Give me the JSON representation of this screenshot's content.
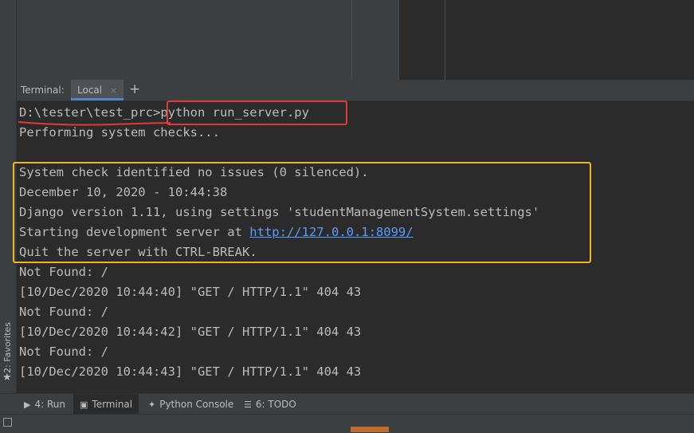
{
  "terminal": {
    "title": "Terminal:",
    "tab_label": "Local",
    "tab_close": "×",
    "add_tab": "+",
    "lines": {
      "cmd_path": "D:\\tester\\test_prc>",
      "cmd_text": "python run_server.py",
      "l1": "Performing system checks...",
      "l2": "System check identified no issues (0 silenced).",
      "l3": "December 10, 2020 - 10:44:38",
      "l4": "Django version 1.11, using settings 'studentManagementSystem.settings'",
      "l5_prefix": "Starting development server at ",
      "l5_link": "http://127.0.0.1:8099/",
      "l6": "Quit the server with CTRL-BREAK.",
      "l7": "Not Found: /",
      "l8": "[10/Dec/2020 10:44:40] \"GET / HTTP/1.1\" 404 43",
      "l9": "Not Found: /",
      "l10": "[10/Dec/2020 10:44:42] \"GET / HTTP/1.1\" 404 43",
      "l11": "Not Found: /",
      "l12": "[10/Dec/2020 10:44:43] \"GET / HTTP/1.1\" 404 43"
    }
  },
  "left_strip": {
    "favorites_label": "2: Favorites"
  },
  "bottom_bar": {
    "run_label": "4: Run",
    "terminal_label": "Terminal",
    "python_console_label": "Python Console",
    "todo_label": "6: TODO"
  },
  "icons": {
    "run": "play-icon",
    "terminal": "terminal-icon",
    "python_console": "python-icon",
    "todo": "todo-icon",
    "favorites": "star-icon"
  },
  "colors": {
    "annotation_red": "#e03a3a",
    "annotation_yellow": "#f0b429",
    "link": "#589df6"
  }
}
